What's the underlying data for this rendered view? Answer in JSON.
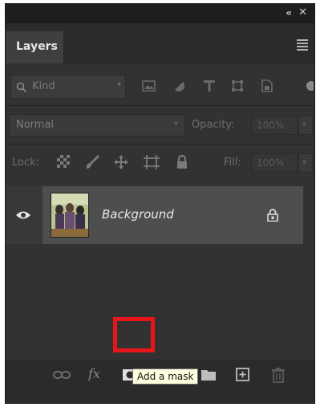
{
  "window": {
    "collapse_glyph": "«",
    "close_glyph": "✕"
  },
  "tabs": [
    {
      "label": "Layers"
    }
  ],
  "filter": {
    "kind_label": "Kind",
    "icons": [
      "pixel-layer-filter-icon",
      "adjustment-layer-filter-icon",
      "type-layer-filter-icon",
      "shape-layer-filter-icon",
      "smart-object-filter-icon"
    ]
  },
  "blend": {
    "mode": "Normal",
    "opacity_label": "Opacity:",
    "opacity_value": "100%"
  },
  "lock": {
    "label": "Lock:",
    "icons": [
      "lock-transparent-pixels-icon",
      "lock-image-pixels-icon",
      "lock-position-icon",
      "lock-artboard-icon",
      "lock-all-icon"
    ],
    "fill_label": "Fill:",
    "fill_value": "100%"
  },
  "layers": [
    {
      "name": "Background",
      "visible": true,
      "locked": true
    }
  ],
  "bottom_bar": {
    "fx_label": "fx",
    "icons": [
      "link-layers-icon",
      "layer-style-icon",
      "add-mask-icon",
      "adjustment-layer-icon",
      "group-folder-icon",
      "new-layer-icon",
      "delete-layer-icon"
    ]
  },
  "tooltip": {
    "text": "Add a mask"
  },
  "colors": {
    "panel_bg": "#323232",
    "highlight": "#e8161a",
    "tooltip_bg": "#ffffdf"
  }
}
